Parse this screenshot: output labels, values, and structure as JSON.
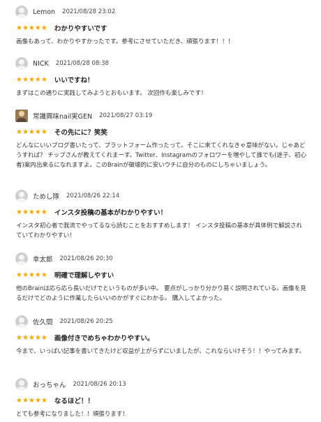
{
  "reviews": [
    {
      "user": "Lemon",
      "date": "2021/08/28 23:02",
      "stars": "★★★★★",
      "title": "わかりやすいです",
      "body": "画像もあって、わかりやすかったです。参考にさせていただき、頑張ります！！！",
      "avatar": "default-avatar"
    },
    {
      "user": "NICK",
      "date": "2021/08/28 08:38",
      "stars": "★★★★★",
      "title": "いいですね！",
      "body": "まずはこの通りに実践してみようとおもいます。 次回作も楽しみです！",
      "avatar": "default-avatar"
    },
    {
      "user": "常識興味nail実GEN",
      "date": "2021/08/27 03:19",
      "stars": "★★★★★",
      "title": "その先にに？笑笑",
      "body": "どんなにいいブログ書いたって、プラットフォーム作ったって。そこに来てくれなきゃ意味がない。じゃあどうすれば？ チップさんが教えてくれまーす。Twitter、Instagramのフォロワーを増やして誰でも(迷子、初心者)案内出来るになれますよ。このBrainが破壊的に安いウチに自分のものにしちゃいましょう。",
      "avatar": "photo-avatar"
    },
    {
      "user": "ためし隊",
      "date": "2021/08/26 22:14",
      "stars": "★★★★★",
      "title": "インスタ投稿の基本がわかりやすい！",
      "body": "インスタ初心者で我流でやってるなら読むことをおすすめします！ インスタ投稿の基本が具体例で解説されていてわかりやすい！",
      "avatar": "default-avatar"
    },
    {
      "user": "幸太郎",
      "date": "2021/08/26 20:30",
      "stars": "★★★★★",
      "title": "明確で理解しやすい",
      "body": "他のBrainは応ら応ら長いだけでというものが多い中。 要点がしっかり分かり易く説明されている。画像を見るだけでどのように作業したらいいのかがすぐにわかる。 購入してよかった。",
      "avatar": "default-avatar"
    },
    {
      "user": "佐久間",
      "date": "2021/08/26 20:25",
      "stars": "★★★★★",
      "title": "画像付きでめちゃわかりやすい。",
      "body": "今まで、いっぱい記事を書いてきたけど収益が上がらずにいましたが、これならいけそう！！やってみます。",
      "avatar": "default-avatar"
    },
    {
      "user": "おっちゃん",
      "date": "2021/08/26 20:13",
      "stars": "★★★★★",
      "title": "なるほど！！",
      "body": "とても参考になりました！！頑張ります！",
      "avatar": "default-avatar"
    }
  ]
}
